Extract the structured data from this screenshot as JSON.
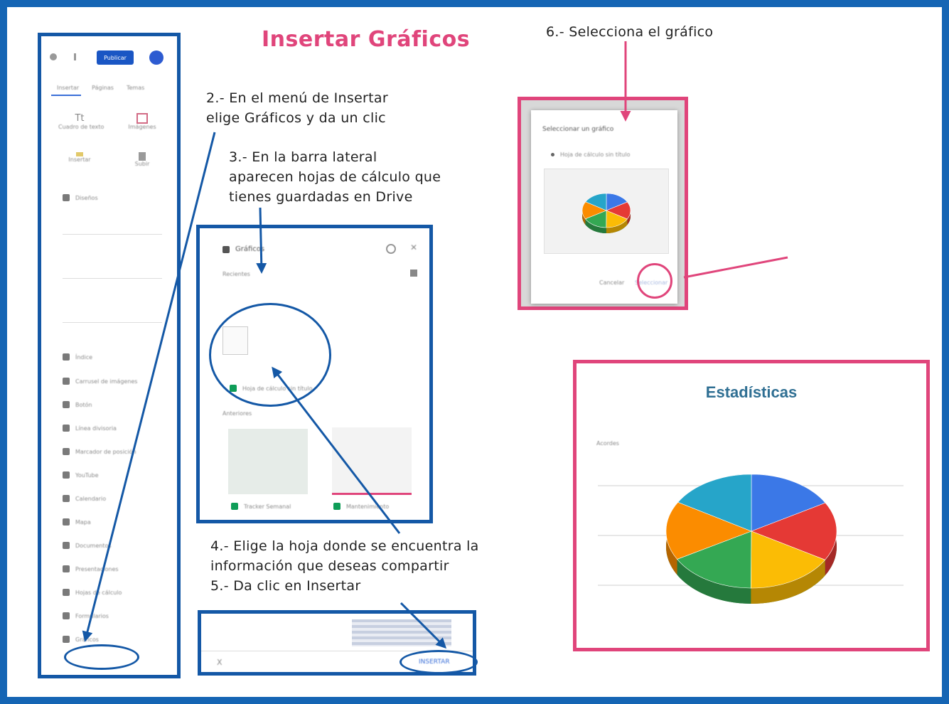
{
  "title": "Insertar Gráficos",
  "steps": {
    "s2": "2.- En el menú de Insertar\nelige Gráficos y da un clic",
    "s3": "3.- En la barra lateral\naparecen hojas de cálculo que\ntienes guardadas en Drive",
    "s45": "4.- Elige la hoja donde se encuentra la\ninformación  que deseas compartir\n5.- Da clic en Insertar",
    "s6": "6.- Selecciona el gráfico"
  },
  "sidebar": {
    "publish_label": "Publicar",
    "tabs": [
      "Insertar",
      "Páginas",
      "Temas"
    ],
    "items": [
      "Cuadro de texto",
      "Imágenes",
      "Insertar",
      "Subir",
      "Diseños",
      "Índice",
      "Carrusel de imágenes",
      "Botón",
      "Línea divisoria",
      "Marcador de posición",
      "YouTube",
      "Calendario",
      "Mapa",
      "Documentos",
      "Presentaciones",
      "Hojas de cálculo",
      "Formularios",
      "Gráficos"
    ]
  },
  "charts_panel": {
    "title": "Gráficos",
    "recent_label": "Recientes",
    "sheet1": "Hoja de cálculo sin título",
    "other_label": "Anteriores",
    "sheet2": "Tracker Semanal",
    "sheet3": "Mantenimiento"
  },
  "insert_bar": {
    "close": "X",
    "insert_label": "INSERTAR"
  },
  "select_dialog": {
    "title": "Seleccionar un gráfico",
    "option": "Hoja de cálculo sin título",
    "cancel": "Cancelar",
    "select": "Seleccionar"
  },
  "stats": {
    "title": "Estadísticas",
    "subtitle": "Acordes"
  },
  "colors": {
    "blue_frame": "#1458a6",
    "pink_frame": "#e0457b"
  },
  "chart_data": {
    "type": "pie",
    "title": "Estadísticas",
    "categories": [
      "",
      "",
      "",
      "",
      "",
      ""
    ],
    "values": [
      16.7,
      16.7,
      16.7,
      16.7,
      16.7,
      16.5
    ],
    "colors": [
      "#3b78e7",
      "#e53935",
      "#fbbc05",
      "#34a853",
      "#fb8c00",
      "#26a5c9"
    ]
  }
}
